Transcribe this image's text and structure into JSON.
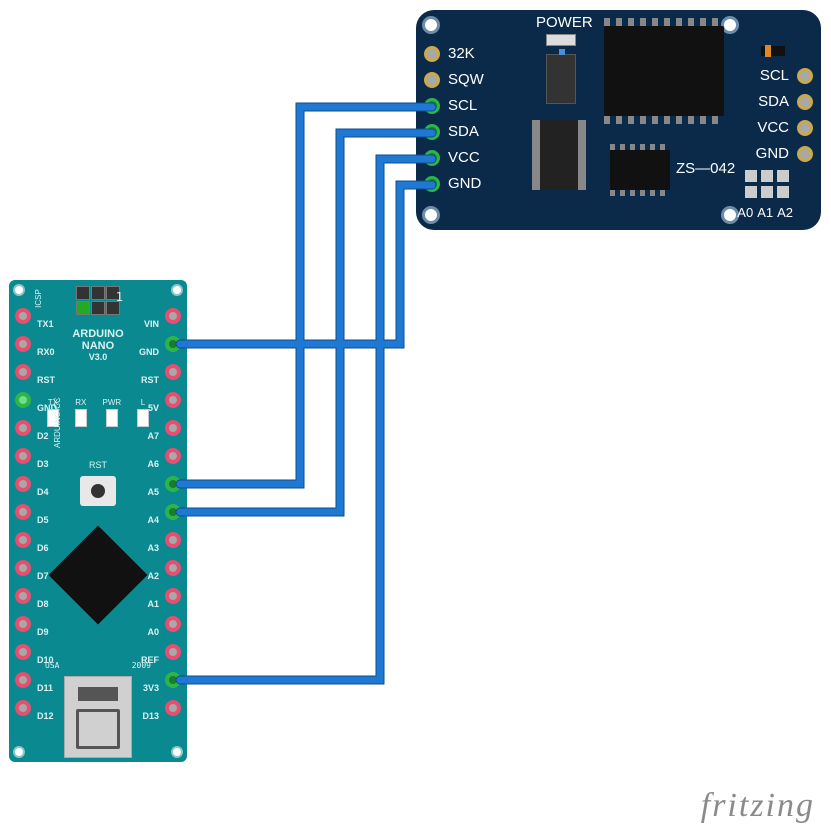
{
  "diagram": {
    "arduino": {
      "brand": "ARDUINO",
      "name": "NANO",
      "version": "V3.0",
      "url_text": "ARDUINO.CC",
      "icsp_label": "ICSP",
      "one_label": "1",
      "rst_label": "RST",
      "usa_label": "USA",
      "year_label": "2009",
      "left_pin_labels": [
        "TX1",
        "RX0",
        "RST",
        "GND",
        "D2",
        "D3",
        "D4",
        "D5",
        "D6",
        "D7",
        "D8",
        "D9",
        "D10",
        "D11",
        "D12"
      ],
      "right_pin_labels": [
        "VIN",
        "GND",
        "RST",
        "5V",
        "A7",
        "A6",
        "A5",
        "A4",
        "A3",
        "A2",
        "A1",
        "A0",
        "REF",
        "3V3",
        "D13"
      ],
      "led_labels": {
        "tx": "TX",
        "rx": "RX",
        "pwr": "PWR",
        "l": "L"
      }
    },
    "rtc": {
      "power_label": "POWER",
      "model": "ZS—042",
      "left_pins": [
        "32K",
        "SQW",
        "SCL",
        "SDA",
        "VCC",
        "GND"
      ],
      "right_pins": [
        "SCL",
        "SDA",
        "VCC",
        "GND"
      ],
      "addr_labels": [
        "A0",
        "A1",
        "A2"
      ]
    },
    "connections": [
      {
        "from": "nano.A5",
        "to": "rtc.SCL"
      },
      {
        "from": "nano.A4",
        "to": "rtc.SDA"
      },
      {
        "from": "nano.3V3",
        "to": "rtc.VCC"
      },
      {
        "from": "nano.GND",
        "to": "rtc.GND"
      }
    ],
    "watermark": "fritzing"
  },
  "chart_data": {
    "type": "wiring-diagram",
    "nodes": [
      {
        "id": "arduino-nano",
        "label": "Arduino Nano V3.0"
      },
      {
        "id": "ds3231-rtc",
        "label": "ZS-042 RTC module"
      }
    ],
    "edges": [
      {
        "source": "arduino-nano",
        "source_pin": "A5",
        "target": "ds3231-rtc",
        "target_pin": "SCL"
      },
      {
        "source": "arduino-nano",
        "source_pin": "A4",
        "target": "ds3231-rtc",
        "target_pin": "SDA"
      },
      {
        "source": "arduino-nano",
        "source_pin": "3V3",
        "target": "ds3231-rtc",
        "target_pin": "VCC"
      },
      {
        "source": "arduino-nano",
        "source_pin": "GND",
        "target": "ds3231-rtc",
        "target_pin": "GND"
      }
    ]
  }
}
